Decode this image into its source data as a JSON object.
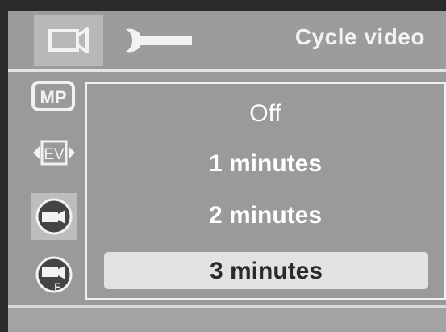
{
  "header": {
    "title": "Cycle video",
    "tabs": [
      {
        "icon": "video-camera-icon",
        "selected": true
      },
      {
        "icon": "wrench-icon",
        "selected": false
      }
    ]
  },
  "sidebar": {
    "items": [
      {
        "icon": "mp-resolution-icon",
        "label": "MP"
      },
      {
        "icon": "ev-exposure-icon",
        "label": "EV"
      },
      {
        "icon": "cycle-video-icon",
        "selected": true
      },
      {
        "icon": "video-f-icon",
        "label": "F"
      }
    ]
  },
  "menu": {
    "options": [
      "Off",
      "1 minutes",
      "2 minutes",
      "3 minutes"
    ],
    "selected_index": 3
  },
  "colors": {
    "background": "#9a9a9a",
    "highlight": "#e2e2e2",
    "text": "#ffffff"
  }
}
